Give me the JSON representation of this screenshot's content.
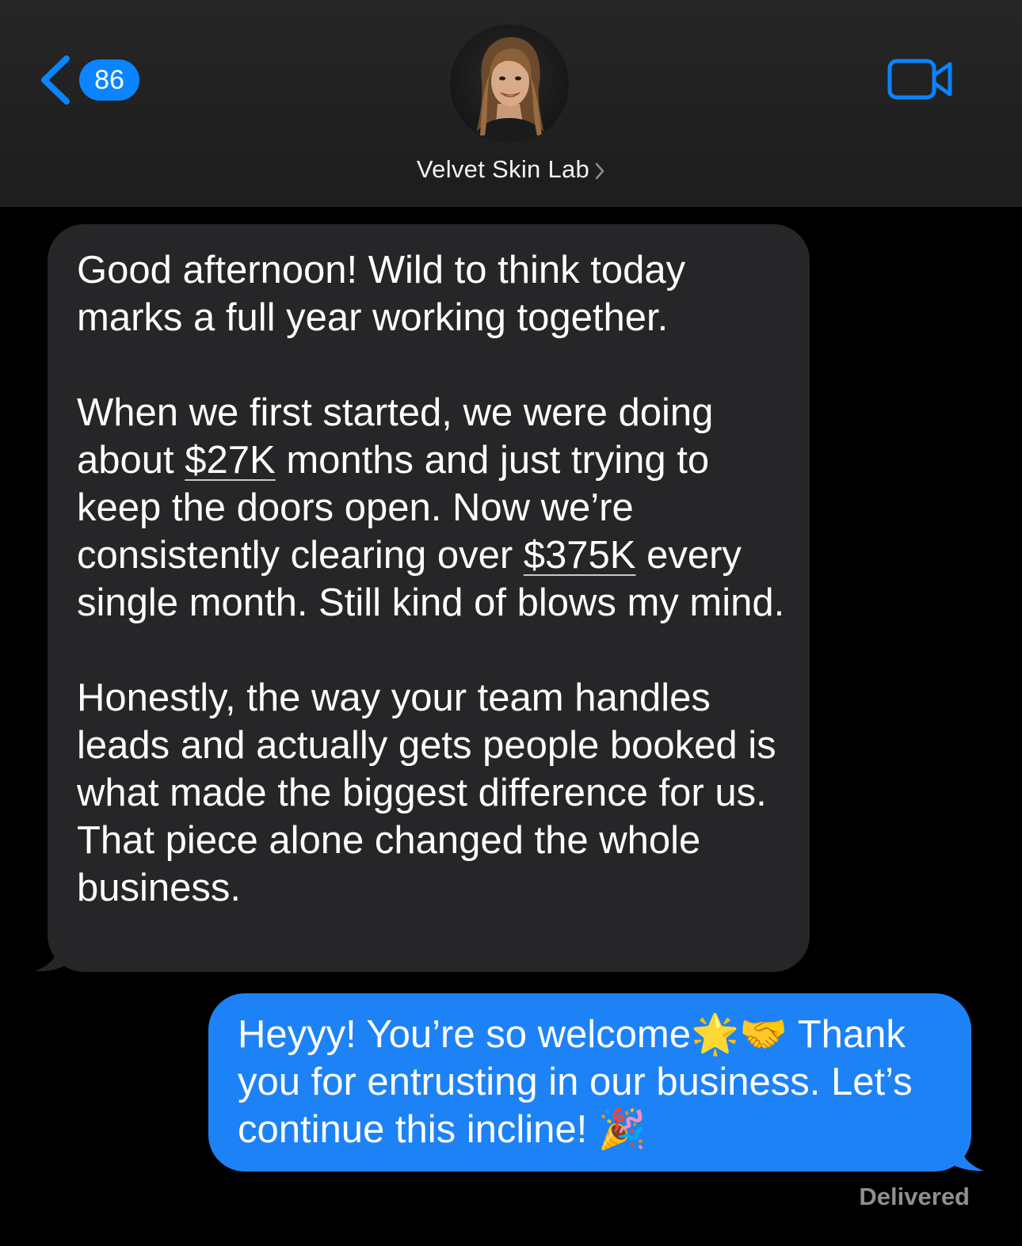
{
  "header": {
    "back_badge_count": "86",
    "contact_name": "Velvet Skin Lab",
    "icons": {
      "back": "chevron-left-icon",
      "video": "video-camera-icon",
      "name_chevron": "chevron-right-icon"
    }
  },
  "messages": [
    {
      "direction": "incoming",
      "paragraphs": [
        "Good afternoon! Wild to think today marks a full year working together.",
        "When we first started, we were doing about",
        "$27K",
        "months and just trying to keep the doors open. Now we’re consistently clearing over",
        "$375K",
        "every single month. Still kind of blows my mind.",
        "Honestly, the way your team handles leads and actually gets people booked is what made the biggest difference for us. That piece alone changed the whole business."
      ]
    },
    {
      "direction": "outgoing",
      "text_part1": "Heyyy! You’re so welcome",
      "emoji1": "🌟",
      "emoji2": "🤝",
      "text_part2": "Thank you for entrusting in our business. Let’s continue this incline!",
      "emoji3": "🎉",
      "status": "Delivered"
    }
  ],
  "colors": {
    "accent": "#0a84ff",
    "incoming_bubble": "#262628",
    "outgoing_bubble": "#1d82f6",
    "status_text": "#8e8e93"
  }
}
